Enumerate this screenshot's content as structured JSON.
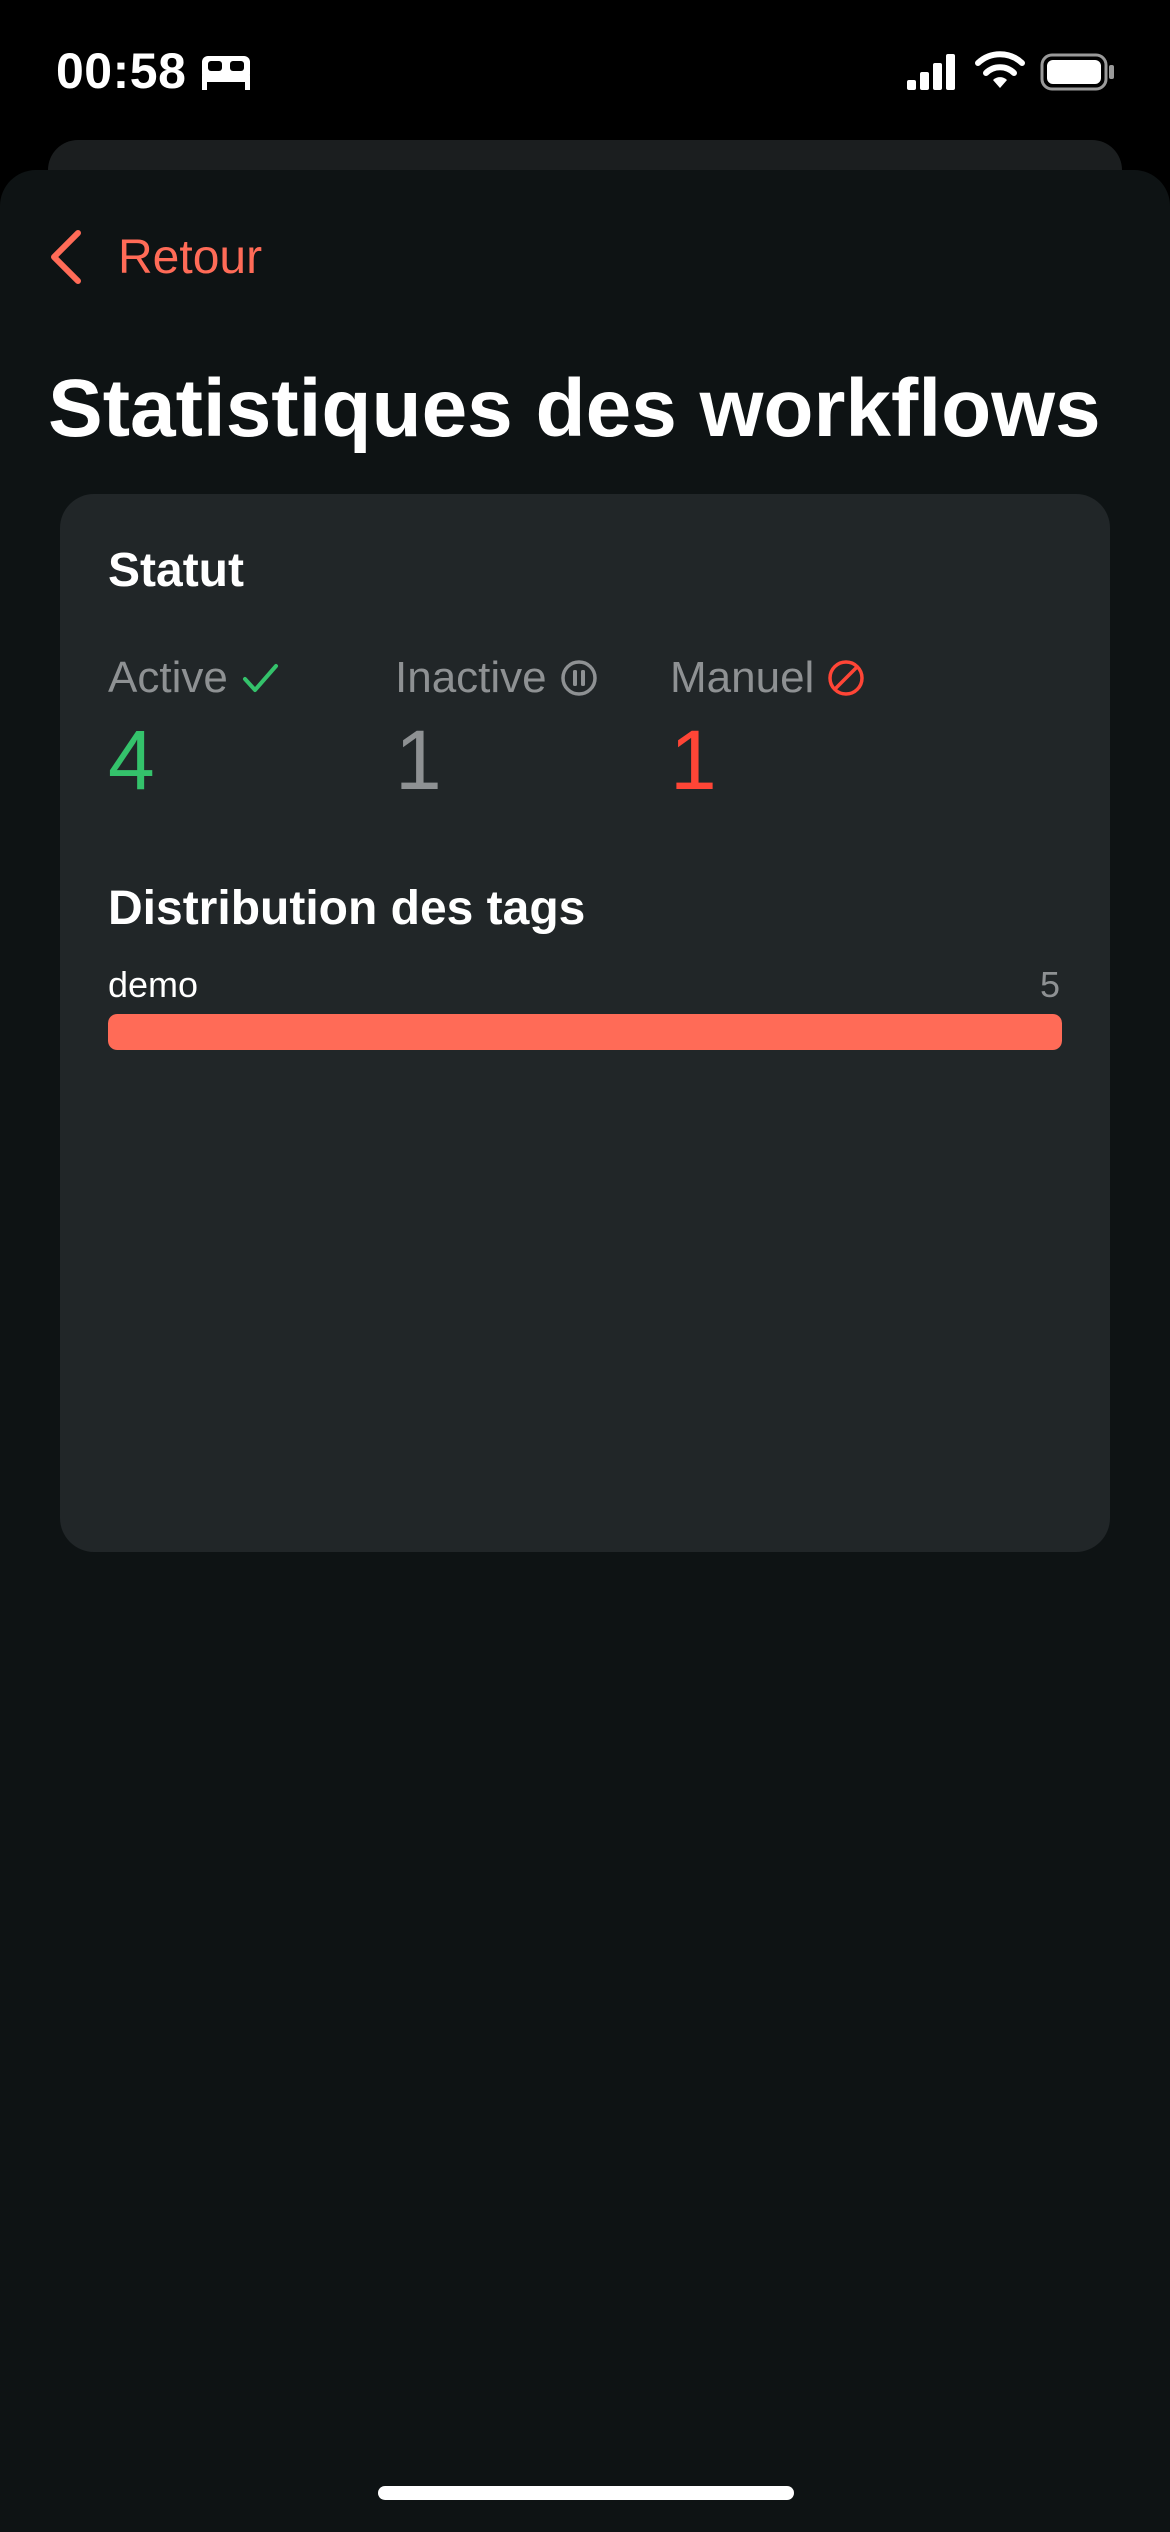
{
  "status_bar": {
    "time": "00:58",
    "icons": [
      "bed-icon",
      "signal-icon",
      "wifi-icon",
      "battery-icon"
    ]
  },
  "nav": {
    "back_label": "Retour",
    "back_icon": "chevron-left-icon"
  },
  "title": "Statistiques des workflows",
  "status_section": {
    "title": "Statut",
    "stats": [
      {
        "label": "Active",
        "value": "4",
        "icon": "check-icon",
        "color": "#34c26b"
      },
      {
        "label": "Inactive",
        "value": "1",
        "icon": "pause-circle-icon",
        "color": "#8e9193"
      },
      {
        "label": "Manuel",
        "value": "1",
        "icon": "prohibited-icon",
        "color": "#ff4536"
      }
    ]
  },
  "tags_section": {
    "title": "Distribution des tags",
    "tags": [
      {
        "name": "demo",
        "count": "5",
        "fraction": 1.0
      }
    ]
  },
  "colors": {
    "accent": "#ff6b57",
    "background": "#0e1314",
    "card": "#212628",
    "active": "#34c26b",
    "inactive": "#8e9193",
    "manual": "#ff4536"
  }
}
